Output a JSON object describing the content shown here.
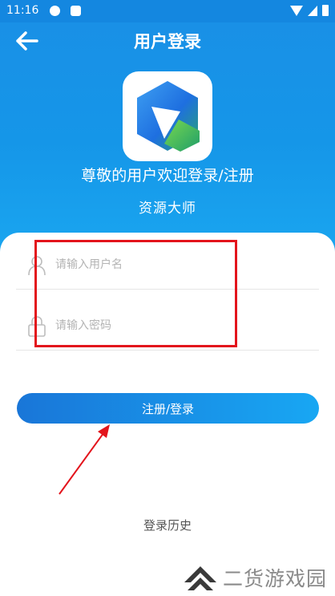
{
  "status_bar": {
    "time": "11:16",
    "icons": [
      "app-notification-icon",
      "app-notification-icon",
      "wifi-icon",
      "signal-icon",
      "battery-icon"
    ]
  },
  "header": {
    "back_icon": "arrow-left-icon",
    "title": "用户登录"
  },
  "hero": {
    "welcome_text": "尊敬的用户欢迎登录/注册",
    "brand_name": "资源大师",
    "app_icon": "app-logo-icon"
  },
  "form": {
    "username": {
      "placeholder": "请输入用户名",
      "value": "",
      "icon": "user-icon"
    },
    "password": {
      "placeholder": "请输入密码",
      "value": "",
      "icon": "lock-icon"
    },
    "submit_label": "注册/登录"
  },
  "history_link": "登录历史",
  "watermark": {
    "text": "二货游戏园"
  },
  "annotation": {
    "highlight_color": "#e3141c",
    "arrow_color": "#e3141c"
  },
  "colors": {
    "primary": "#1a8fe6",
    "button_start": "#1976d8",
    "button_end": "#18a7f3"
  }
}
